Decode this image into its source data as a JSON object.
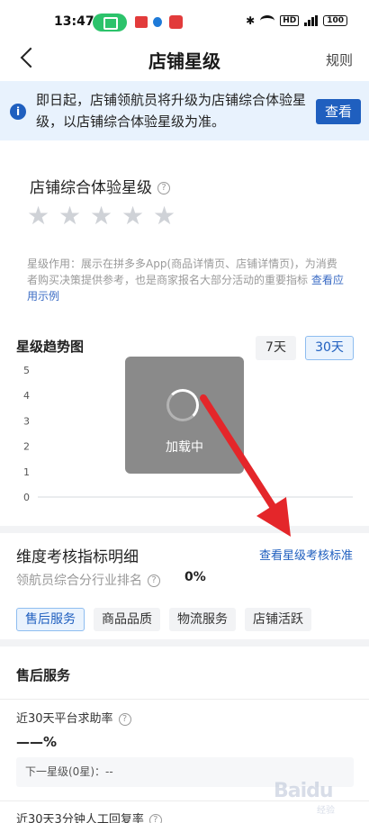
{
  "status_bar": {
    "time": "13:47",
    "battery": "100",
    "network": "HD"
  },
  "nav": {
    "title": "店铺星级",
    "rule": "规则"
  },
  "notice": {
    "text": "即日起，店铺领航员将升级为店铺综合体验星级，以店铺综合体验星级为准。",
    "button": "查看"
  },
  "star_section": {
    "title": "店铺综合体验星级",
    "star_count": 5,
    "rating": 0,
    "desc": "星级作用：展示在拼多多App(商品详情页、店铺详情页)，为消费者购买决策提供参考，也是商家报名大部分活动的重要指标",
    "link": "查看应用示例"
  },
  "trend": {
    "title": "星级趋势图",
    "ranges": [
      "7天",
      "30天"
    ],
    "selected_range": "30天",
    "loading_text": "加载中"
  },
  "chart_data": {
    "type": "line",
    "title": "星级趋势图",
    "xlabel": "",
    "ylabel": "",
    "ylim": [
      0,
      5
    ],
    "yticks": [
      "5",
      "4",
      "3",
      "2",
      "1",
      "0"
    ],
    "series": []
  },
  "dims": {
    "title": "维度考核指标明细",
    "link": "查看星级考核标准",
    "rank_label": "领航员综合分行业排名",
    "rank_value": "0%",
    "tabs": [
      "售后服务",
      "商品品质",
      "物流服务",
      "店铺活跃"
    ],
    "active_tab": "售后服务"
  },
  "after_sales": {
    "title": "售后服务",
    "metric1_label": "近30天平台求助率",
    "metric1_value": "——%",
    "next_level": "下一星级(0星)：--",
    "metric2_label": "近30天3分钟人工回复率"
  },
  "colors": {
    "accent": "#1f5fbf",
    "arrow": "#e4262a",
    "notice_bg": "#e8f2fd"
  },
  "watermark": {
    "text": "Baidu",
    "sub": "经验"
  }
}
